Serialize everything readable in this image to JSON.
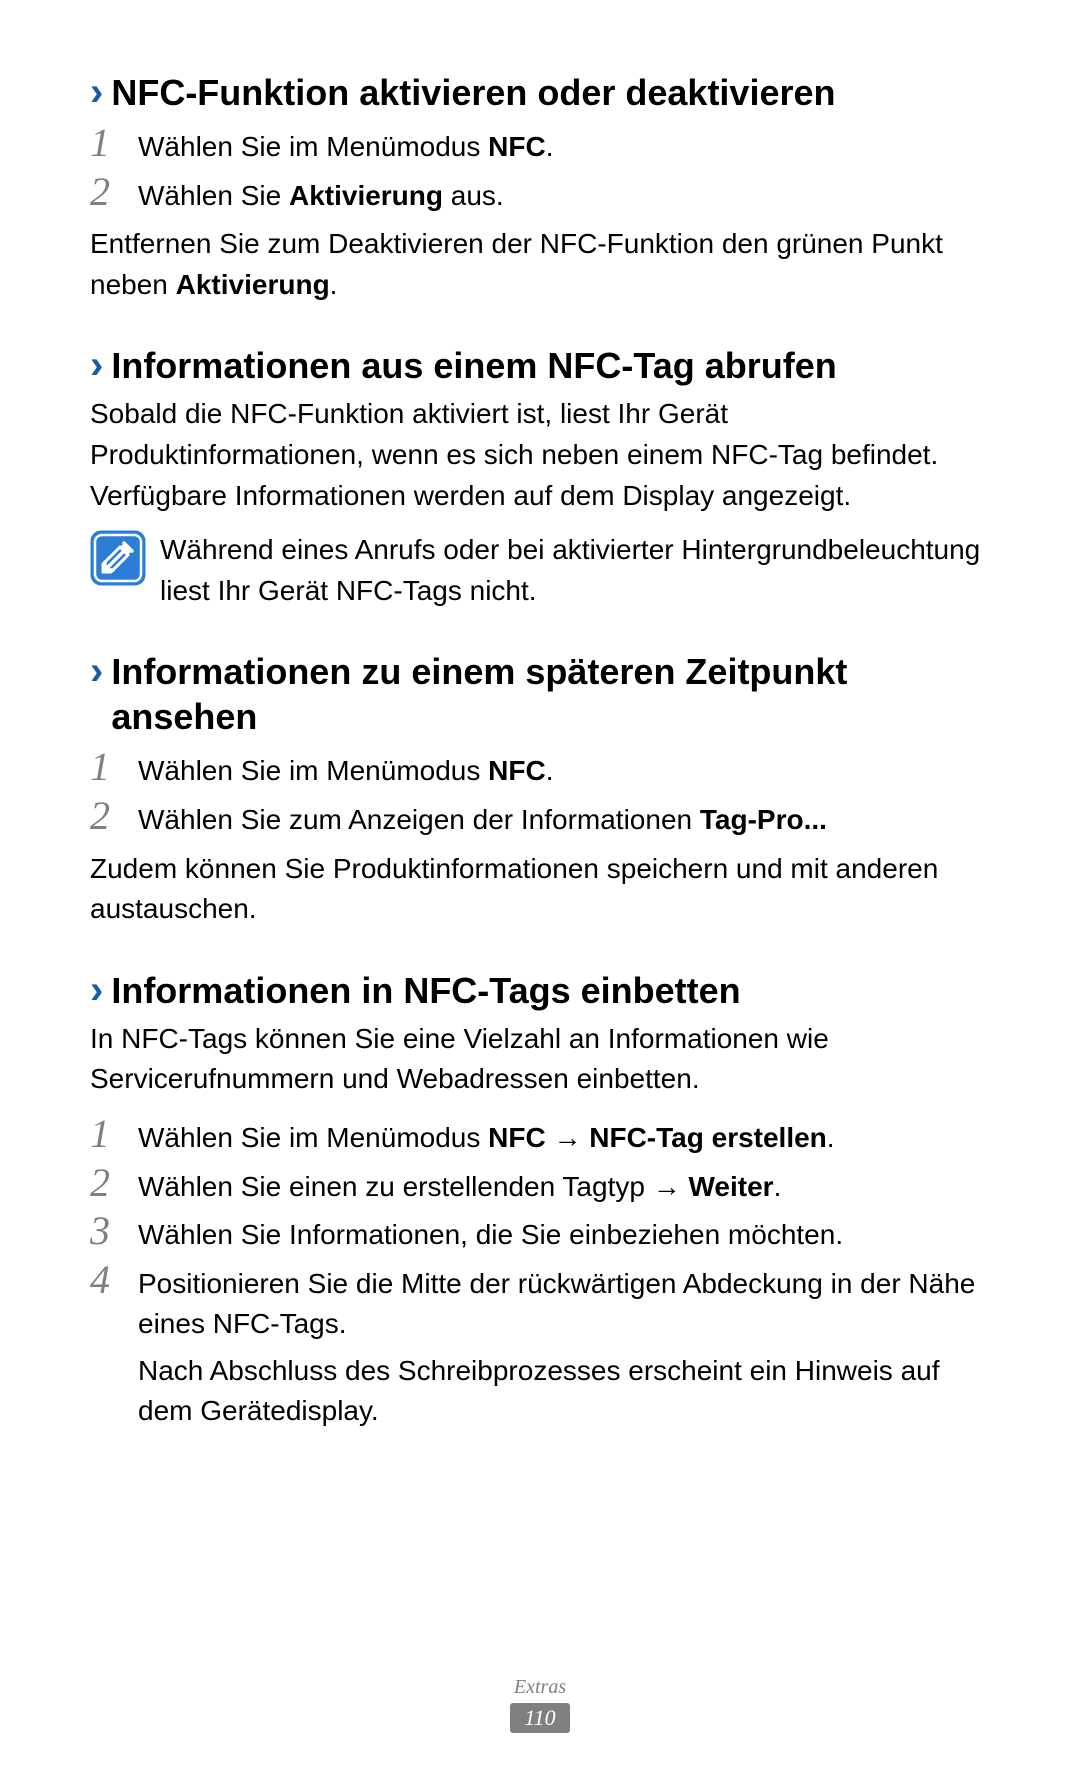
{
  "sections": {
    "s1": {
      "title": "NFC-Funktion aktivieren oder deaktivieren",
      "step1_pre": "Wählen Sie im Menümodus ",
      "step1_bold": "NFC",
      "step1_post": ".",
      "step2_pre": "Wählen Sie ",
      "step2_bold": "Aktivierung",
      "step2_post": " aus.",
      "para_pre": "Entfernen Sie zum Deaktivieren der NFC-Funktion den grünen Punkt neben ",
      "para_bold": "Aktivierung",
      "para_post": "."
    },
    "s2": {
      "title": "Informationen aus einem NFC-Tag abrufen",
      "para": "Sobald die NFC-Funktion aktiviert ist, liest Ihr Gerät Produktinformationen, wenn es sich neben einem NFC-Tag befindet. Verfügbare Informationen werden auf dem Display angezeigt.",
      "note": "Während eines Anrufs oder bei aktivierter Hintergrundbeleuchtung liest Ihr Gerät NFC-Tags nicht."
    },
    "s3": {
      "title": "Informationen zu einem späteren Zeitpunkt ansehen",
      "step1_pre": "Wählen Sie im Menümodus ",
      "step1_bold": "NFC",
      "step1_post": ".",
      "step2_pre": "Wählen Sie zum Anzeigen der Informationen ",
      "step2_bold": "Tag-Pro...",
      "para": "Zudem können Sie Produktinformationen speichern und mit anderen austauschen."
    },
    "s4": {
      "title": "Informationen in NFC-Tags einbetten",
      "intro": "In NFC-Tags können Sie eine Vielzahl an Informationen wie Servicerufnummern und Webadressen einbetten.",
      "step1_pre": "Wählen Sie im Menümodus ",
      "step1_bold1": "NFC",
      "step1_arrow": " → ",
      "step1_bold2": "NFC-Tag erstellen",
      "step1_post": ".",
      "step2_pre": "Wählen Sie einen zu erstellenden Tagtyp ",
      "step2_arrow": "→ ",
      "step2_bold": "Weiter",
      "step2_post": ".",
      "step3": "Wählen Sie Informationen, die Sie einbeziehen möchten.",
      "step4a": "Positionieren Sie die Mitte der rückwärtigen Abdeckung in der Nähe eines NFC-Tags.",
      "step4b": "Nach Abschluss des Schreibprozesses erscheint ein Hinweis auf dem Gerätedisplay."
    }
  },
  "nums": {
    "n1": "1",
    "n2": "2",
    "n3": "3",
    "n4": "4"
  },
  "footer": {
    "category": "Extras",
    "page": "110"
  }
}
